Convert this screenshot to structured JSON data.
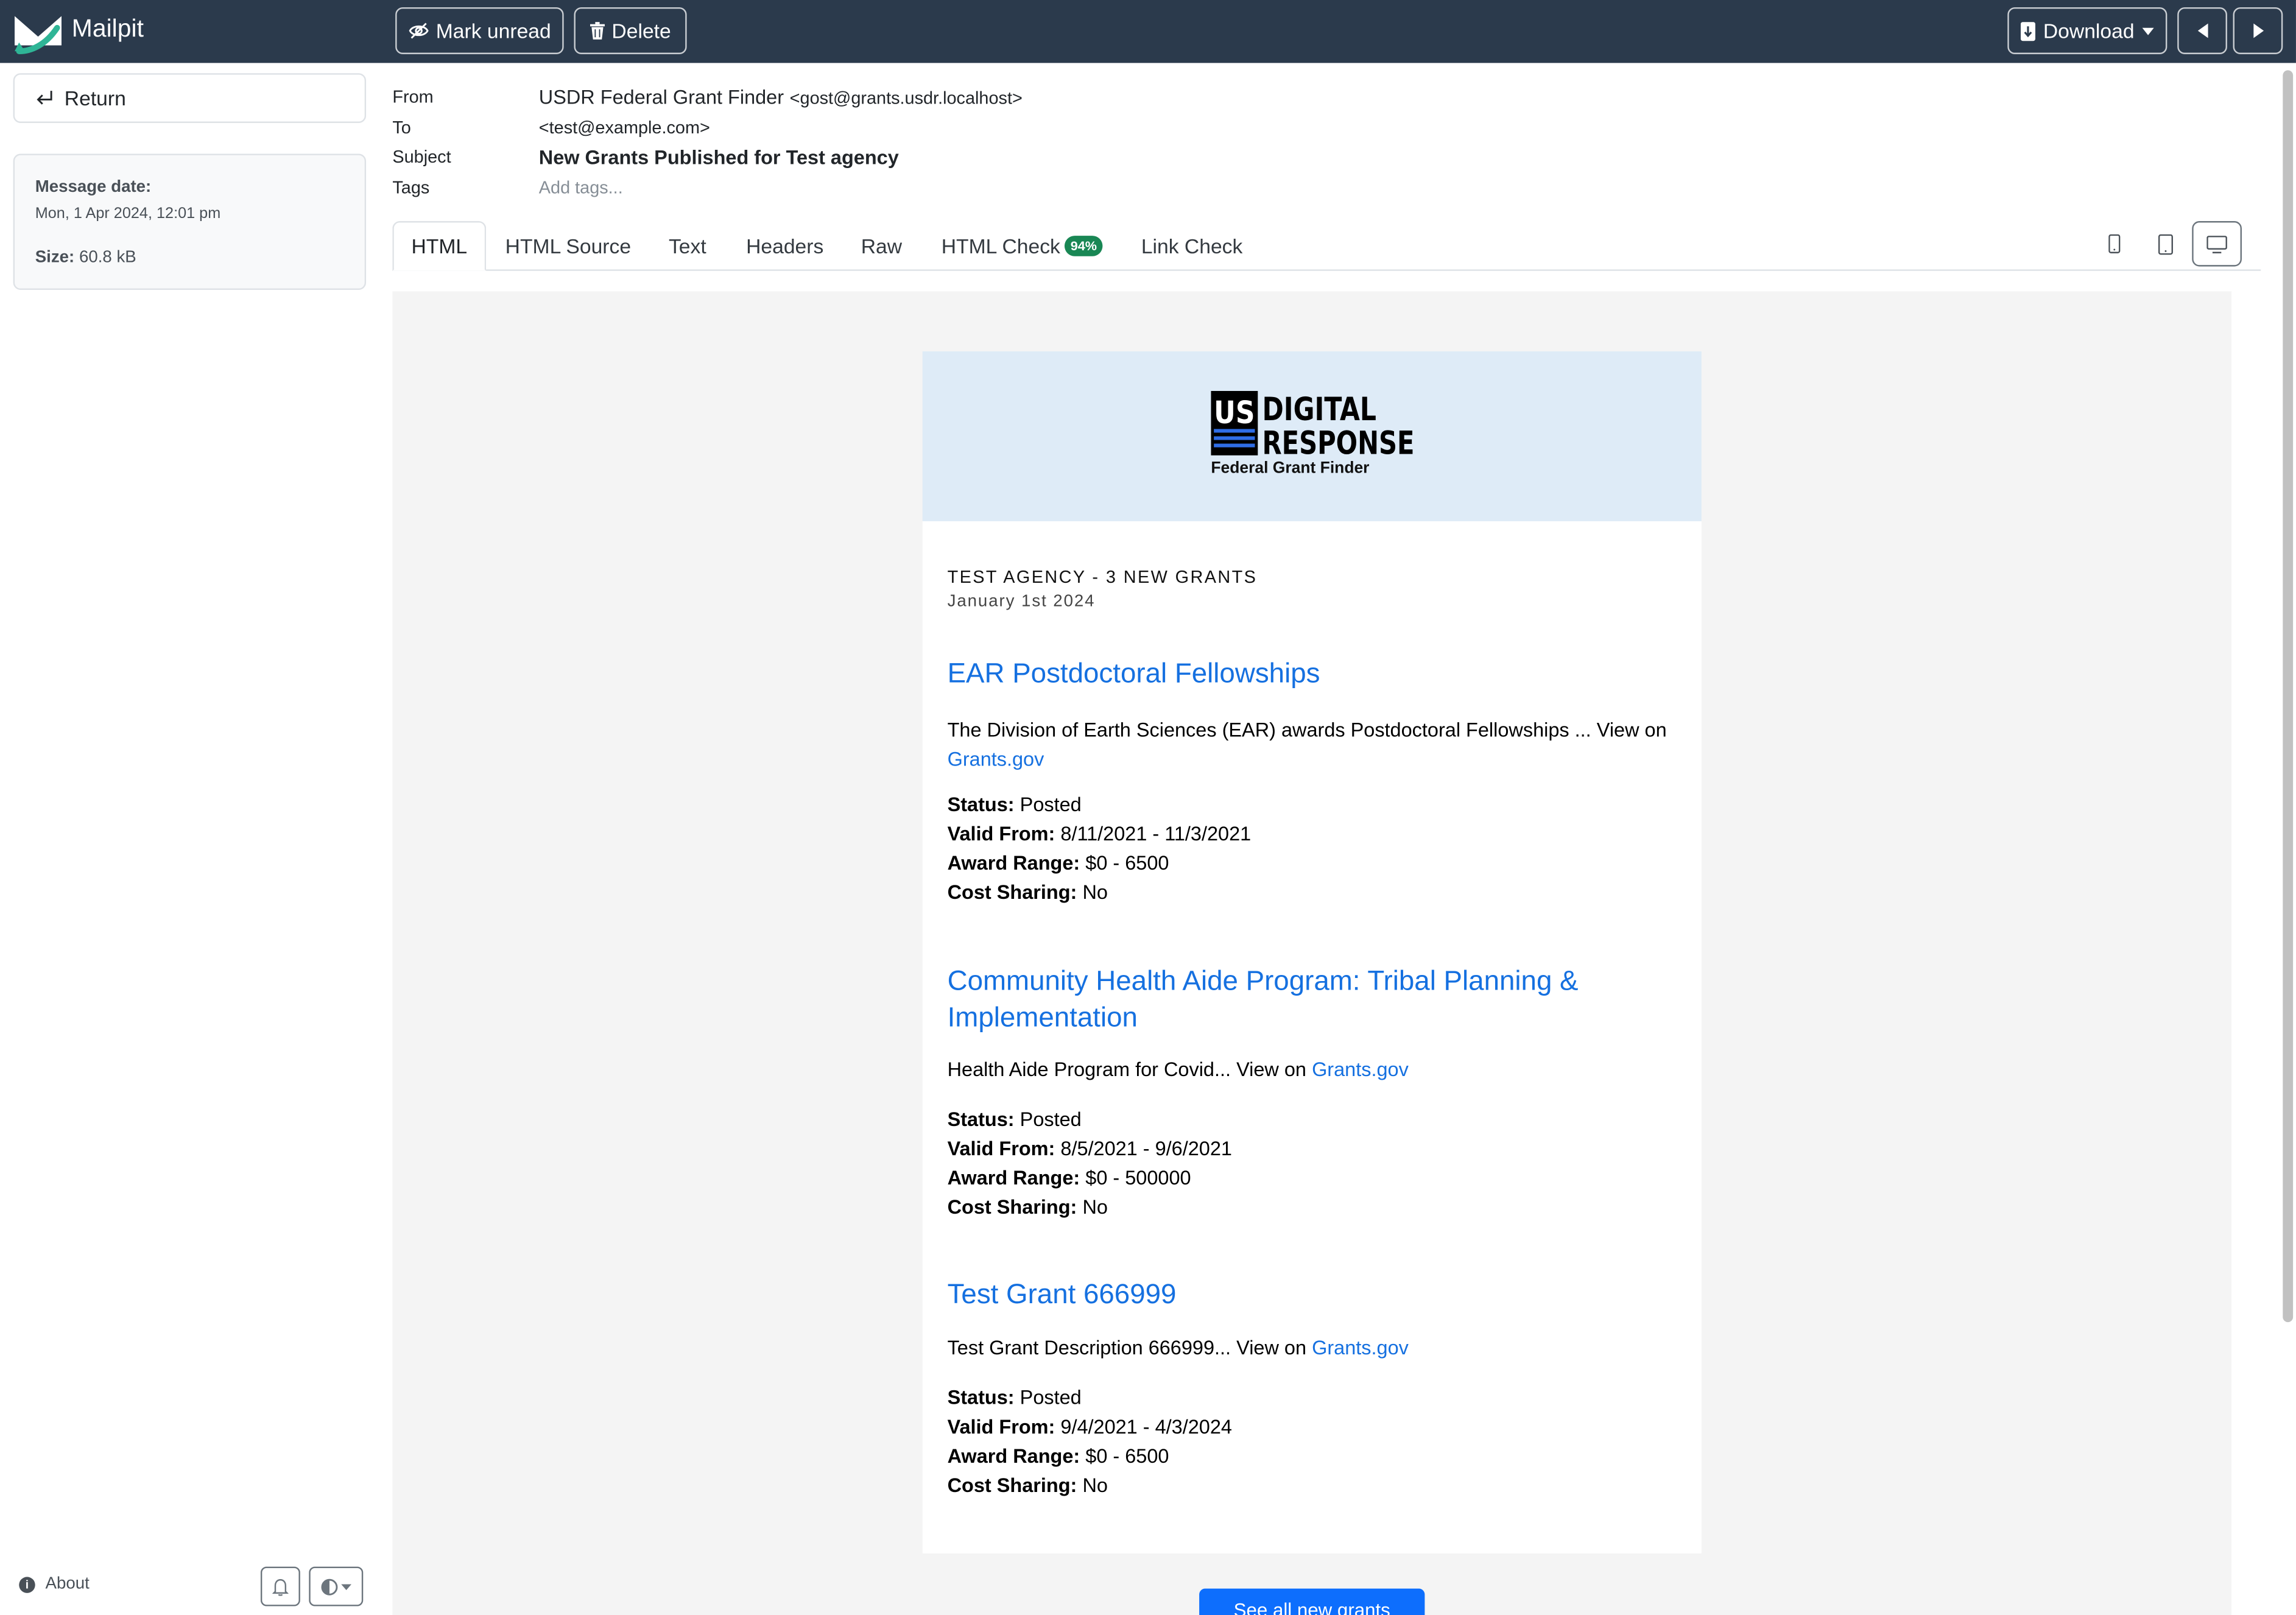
{
  "app": {
    "name": "Mailpit"
  },
  "toolbar": {
    "mark_unread": "Mark unread",
    "delete": "Delete",
    "download": "Download"
  },
  "sidebar": {
    "return": "Return",
    "message_date_label": "Message date:",
    "message_date": "Mon, 1 Apr 2024, 12:01 pm",
    "size_label": "Size:",
    "size": "60.8 kB",
    "about": "About"
  },
  "headers": {
    "from_label": "From",
    "from_name": "USDR Federal Grant Finder",
    "from_email": "<gost@grants.usdr.localhost>",
    "to_label": "To",
    "to_email": "<test@example.com>",
    "subject_label": "Subject",
    "subject": "New Grants Published for Test agency",
    "tags_label": "Tags",
    "tags_placeholder": "Add tags..."
  },
  "tabs": [
    {
      "label": "HTML",
      "active": true
    },
    {
      "label": "HTML Source"
    },
    {
      "label": "Text"
    },
    {
      "label": "Headers"
    },
    {
      "label": "Raw"
    },
    {
      "label": "HTML Check",
      "badge": "94%"
    },
    {
      "label": "Link Check"
    }
  ],
  "email": {
    "logo_text_1": "US",
    "logo_text_2": "DIGITAL",
    "logo_text_3": "RESPONSE",
    "logo_sub": "Federal Grant Finder",
    "title": "TEST AGENCY - 3 NEW GRANTS",
    "date": "January 1st 2024",
    "view_on": "View on",
    "link_text": "Grants.gov",
    "labels": {
      "status": "Status:",
      "valid": "Valid From:",
      "award": "Award Range:",
      "cost": "Cost Sharing:"
    },
    "grants": [
      {
        "title": "EAR Postdoctoral Fellowships",
        "desc": "The Division of Earth Sciences (EAR) awards Postdoctoral Fellowships ...",
        "status": "Posted",
        "valid": "8/11/2021 - 11/3/2021",
        "award": "$0 - 6500",
        "cost": "No"
      },
      {
        "title_1": "Community Health Aide Program: Tribal Planning &",
        "title_2": "Implementation",
        "desc": "Health Aide Program for Covid...",
        "status": "Posted",
        "valid": "8/5/2021 - 9/6/2021",
        "award": "$0 - 500000",
        "cost": "No"
      },
      {
        "title": "Test Grant 666999",
        "desc": "Test Grant Description 666999...",
        "status": "Posted",
        "valid": "9/4/2021 - 4/3/2024",
        "award": "$0 - 6500",
        "cost": "No"
      }
    ],
    "cta": "See all new grants"
  },
  "colors": {
    "navbar": "#2b3a4c",
    "link": "#1570e0",
    "badge": "#198754",
    "cta": "#0d6efd",
    "email_header": "#deebf7"
  }
}
